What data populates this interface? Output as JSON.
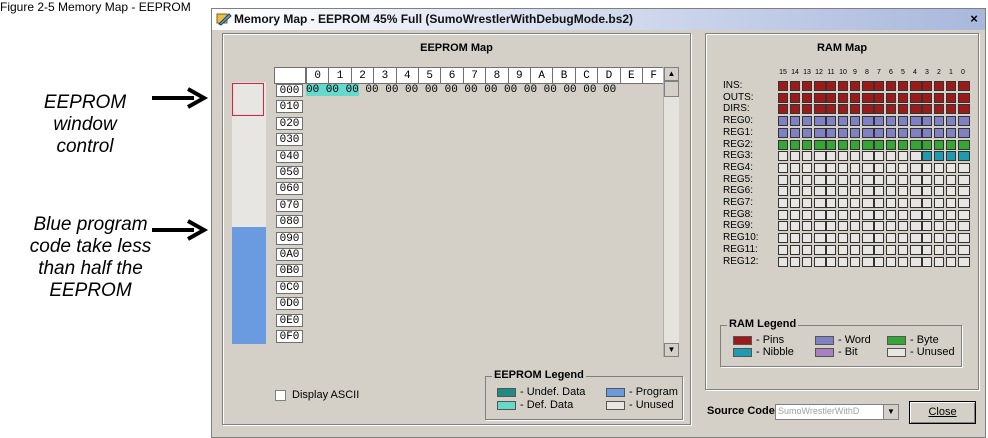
{
  "caption": "Figure 2-5 Memory Map - EEPROM",
  "annotations": {
    "eeprom_window": [
      "EEPROM",
      "window",
      "control"
    ],
    "blue_program": [
      "Blue program",
      "code take less",
      "than half the",
      "EEPROM"
    ]
  },
  "window": {
    "title": "Memory Map - EEPROM 45% Full (SumoWrestlerWithDebugMode.bs2)",
    "close_glyph": "×"
  },
  "eeprom_map": {
    "title": "EEPROM Map",
    "columns": [
      "0",
      "1",
      "2",
      "3",
      "4",
      "5",
      "6",
      "7",
      "8",
      "9",
      "A",
      "B",
      "C",
      "D",
      "E",
      "F"
    ],
    "rows": [
      "000",
      "010",
      "020",
      "030",
      "040",
      "050",
      "060",
      "070",
      "080",
      "090",
      "0A0",
      "0B0",
      "0C0",
      "0D0",
      "0E0",
      "0F0"
    ],
    "row0_highlighted": "00 00 00",
    "row0_rest": " 00 00 00 00 00 00 00 00 00 00 00 00 00",
    "program_fill": 0.45,
    "scroll_up": "▲",
    "scroll_down": "▼"
  },
  "display_ascii": {
    "label": "Display ASCII",
    "checked": false
  },
  "eeprom_legend": {
    "title": "EEPROM Legend",
    "items": [
      {
        "label": "- Undef. Data",
        "color": "#1f8c84"
      },
      {
        "label": "- Program",
        "color": "#6a9ae0"
      },
      {
        "label": "- Def. Data",
        "color": "#66d9cc"
      },
      {
        "label": "- Unused",
        "color": "#e7e6e2"
      }
    ]
  },
  "ram_map": {
    "title": "RAM Map",
    "bit_labels": [
      "15",
      "14",
      "13",
      "12",
      "11",
      "10",
      "9",
      "8",
      "7",
      "6",
      "5",
      "4",
      "3",
      "2",
      "1",
      "0"
    ],
    "rows": [
      {
        "label": "INS:",
        "kind": "pins"
      },
      {
        "label": "OUTS:",
        "kind": "pins"
      },
      {
        "label": "DIRS:",
        "kind": "pins"
      },
      {
        "label": "REG0:",
        "kind": "word"
      },
      {
        "label": "REG1:",
        "kind": "word"
      },
      {
        "label": "REG2:",
        "kind": "byte"
      },
      {
        "label": "REG3:",
        "kind": "nibble_low"
      },
      {
        "label": "REG4:",
        "kind": "unused"
      },
      {
        "label": "REG5:",
        "kind": "unused"
      },
      {
        "label": "REG6:",
        "kind": "unused"
      },
      {
        "label": "REG7:",
        "kind": "unused"
      },
      {
        "label": "REG8:",
        "kind": "unused"
      },
      {
        "label": "REG9:",
        "kind": "unused"
      },
      {
        "label": "REG10:",
        "kind": "unused"
      },
      {
        "label": "REG11:",
        "kind": "unused"
      },
      {
        "label": "REG12:",
        "kind": "unused"
      }
    ],
    "colors": {
      "pins": "#9c1a1a",
      "word": "#8080c4",
      "byte": "#33a633",
      "nibble": "#1f9bb0",
      "bit": "#a680c0",
      "unused": "#e7e6e2"
    }
  },
  "ram_legend": {
    "title": "RAM Legend",
    "items": [
      {
        "label": "- Pins",
        "color": "#9c1a1a"
      },
      {
        "label": "- Word",
        "color": "#8080c4"
      },
      {
        "label": "- Byte",
        "color": "#33a633"
      },
      {
        "label": "- Nibble",
        "color": "#1f9bb0"
      },
      {
        "label": "- Bit",
        "color": "#a680c0"
      },
      {
        "label": "- Unused",
        "color": "#e7e6e2"
      }
    ]
  },
  "source_code": {
    "label": "Source Code",
    "selected": "SumoWrestlerWithD",
    "dropdown_glyph": "▼"
  },
  "close_button": {
    "label": "Close"
  }
}
